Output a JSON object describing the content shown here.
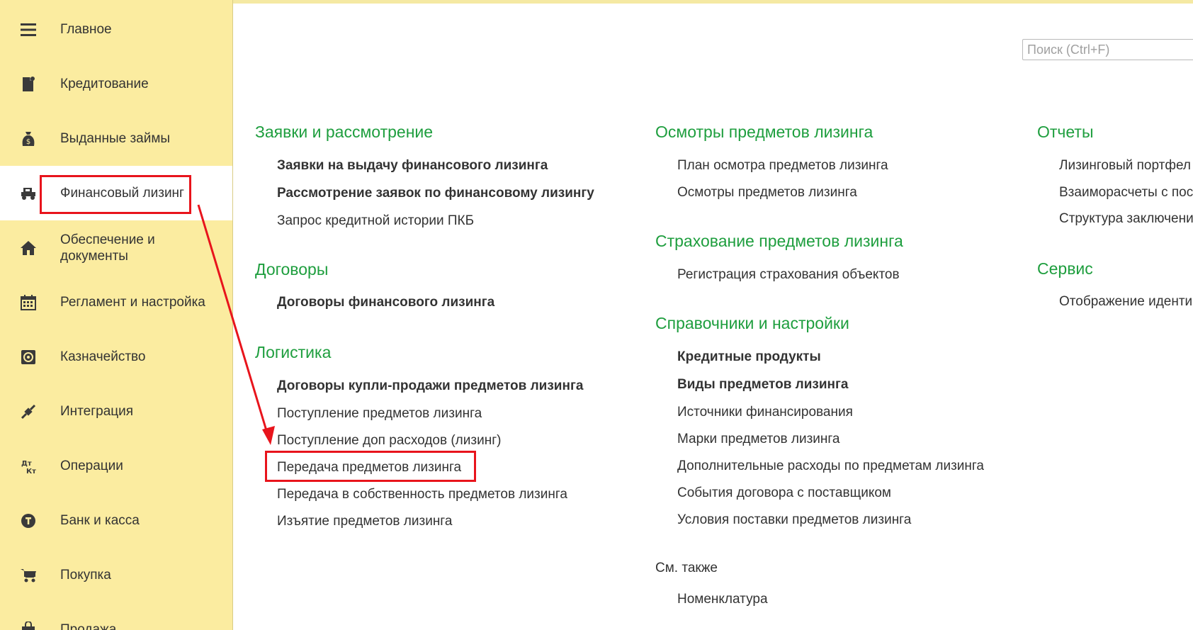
{
  "sidebar": {
    "items": [
      {
        "label": "Главное",
        "icon": "menu-icon"
      },
      {
        "label": "Кредитование",
        "icon": "document-money-icon"
      },
      {
        "label": "Выданные займы",
        "icon": "money-bag-icon"
      },
      {
        "label": "Финансовый лизинг",
        "icon": "truck-icon",
        "active": true
      },
      {
        "label": "Обеспечение и\nдокументы",
        "icon": "house-icon"
      },
      {
        "label": "Регламент и настройка",
        "icon": "calendar-icon"
      },
      {
        "label": "Казначейство",
        "icon": "safe-icon"
      },
      {
        "label": "Интеграция",
        "icon": "plug-icon"
      },
      {
        "label": "Операции",
        "icon": "dt-kt-icon"
      },
      {
        "label": "Банк и касса",
        "icon": "coin-icon"
      },
      {
        "label": "Покупка",
        "icon": "cart-icon"
      },
      {
        "label": "Продажа",
        "icon": "shop-bag-icon"
      }
    ]
  },
  "search": {
    "placeholder": "Поиск (Ctrl+F)",
    "value": ""
  },
  "columns": {
    "col1": {
      "sections": [
        {
          "title": "Заявки и рассмотрение",
          "links": [
            {
              "text": "Заявки на выдачу финансового лизинга",
              "bold": true
            },
            {
              "text": "Рассмотрение заявок по финансовому лизингу",
              "bold": true
            },
            {
              "text": "Запрос кредитной истории ПКБ",
              "bold": false
            }
          ]
        },
        {
          "title": "Договоры",
          "links": [
            {
              "text": "Договоры финансового лизинга",
              "bold": true
            }
          ]
        },
        {
          "title": "Логистика",
          "links": [
            {
              "text": "Договоры купли-продажи предметов лизинга",
              "bold": true
            },
            {
              "text": "Поступление предметов лизинга",
              "bold": false
            },
            {
              "text": "Поступление доп расходов (лизинг)",
              "bold": false
            },
            {
              "text": "Передача предметов лизинга",
              "bold": false
            },
            {
              "text": "Передача в собственность предметов лизинга",
              "bold": false
            },
            {
              "text": "Изъятие предметов лизинга",
              "bold": false
            }
          ]
        }
      ]
    },
    "col2": {
      "sections": [
        {
          "title": "Осмотры предметов лизинга",
          "links": [
            {
              "text": "План осмотра предметов лизинга",
              "bold": false
            },
            {
              "text": "Осмотры предметов лизинга",
              "bold": false
            }
          ]
        },
        {
          "title": "Страхование предметов лизинга",
          "links": [
            {
              "text": "Регистрация страхования объектов",
              "bold": false
            }
          ]
        },
        {
          "title": "Справочники и настройки",
          "links": [
            {
              "text": "Кредитные продукты",
              "bold": true
            },
            {
              "text": "Виды предметов лизинга",
              "bold": true
            },
            {
              "text": "Источники финансирования",
              "bold": false
            },
            {
              "text": "Марки предметов лизинга",
              "bold": false
            },
            {
              "text": "Дополнительные расходы по предметам лизинга",
              "bold": false
            },
            {
              "text": "События договора с поставщиком",
              "bold": false
            },
            {
              "text": "Условия поставки предметов лизинга",
              "bold": false
            }
          ]
        }
      ],
      "see_also": {
        "label": "См. также",
        "links": [
          {
            "text": "Номенклатура",
            "bold": false
          }
        ]
      }
    },
    "col3": {
      "sections": [
        {
          "title": "Отчеты",
          "links": [
            {
              "text": "Лизинговый портфел",
              "bold": false
            },
            {
              "text": "Взаиморасчеты с пос",
              "bold": false
            },
            {
              "text": "Структура заключени",
              "bold": false
            }
          ]
        },
        {
          "title": "Сервис",
          "links": [
            {
              "text": "Отображение иденти",
              "bold": false
            }
          ]
        }
      ]
    }
  },
  "colors": {
    "sidebar_bg": "#fbeca0",
    "section_title": "#1e9e3e",
    "highlight": "#e8141c",
    "text": "#333333"
  }
}
